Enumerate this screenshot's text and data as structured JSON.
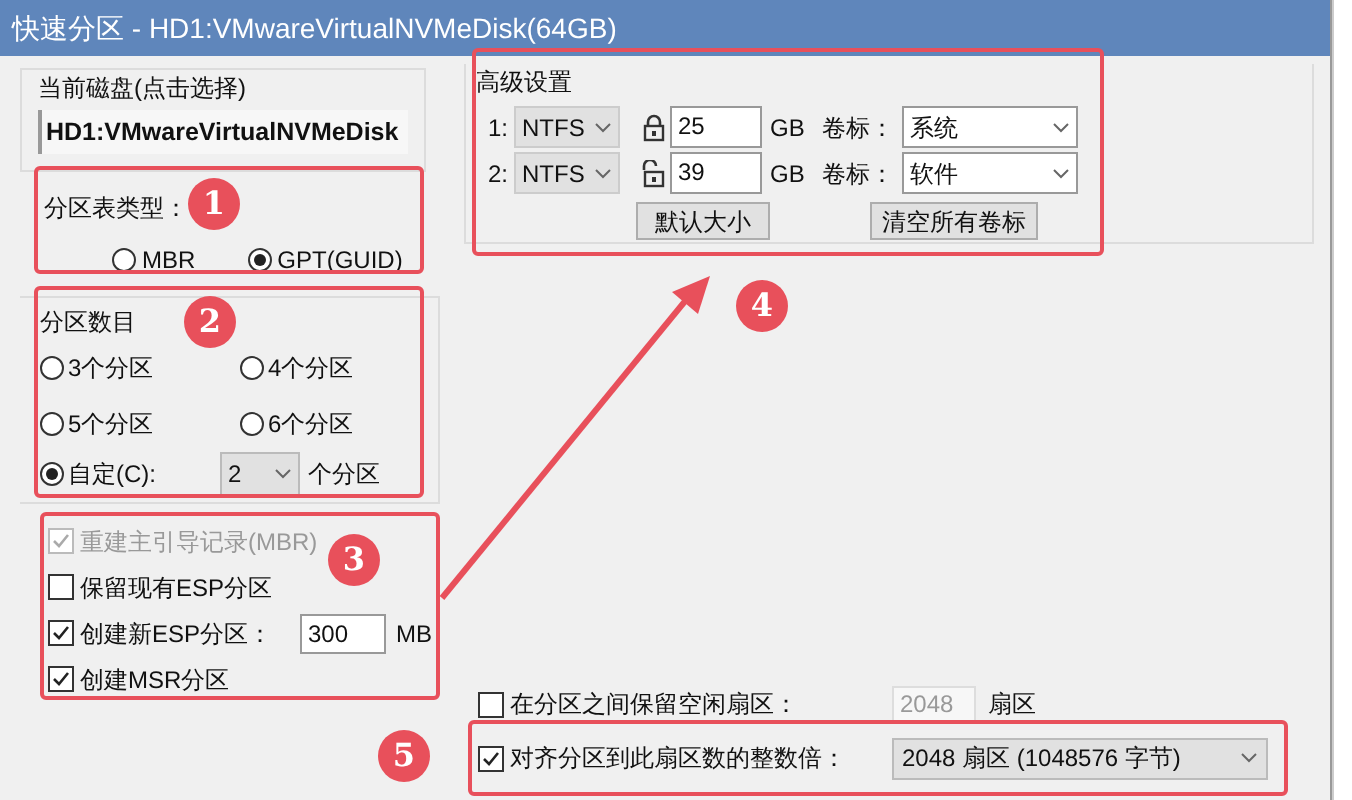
{
  "window": {
    "title": "快速分区 - HD1:VMwareVirtualNVMeDisk(64GB)"
  },
  "current_disk": {
    "label": "当前磁盘(点击选择)",
    "value": "HD1:VMwareVirtualNVMeDisk"
  },
  "partition_table": {
    "label": "分区表类型：",
    "options": [
      {
        "label": "MBR",
        "selected": false
      },
      {
        "label": "GPT(GUID)",
        "selected": true
      }
    ]
  },
  "partition_count": {
    "label": "分区数目",
    "options": [
      {
        "label": "3个分区",
        "selected": false
      },
      {
        "label": "4个分区",
        "selected": false
      },
      {
        "label": "5个分区",
        "selected": false
      },
      {
        "label": "6个分区",
        "selected": false
      }
    ],
    "custom": {
      "label": "自定(C):",
      "selected": true,
      "value": "2",
      "suffix": "个分区"
    }
  },
  "options": [
    {
      "label": "重建主引导记录(MBR)",
      "checked": true,
      "disabled": true
    },
    {
      "label": "保留现有ESP分区",
      "checked": false,
      "disabled": false
    },
    {
      "label": "创建新ESP分区：",
      "checked": true,
      "disabled": false,
      "value": "300",
      "unit": "MB"
    },
    {
      "label": "创建MSR分区",
      "checked": true,
      "disabled": false
    }
  ],
  "advanced": {
    "title": "高级设置",
    "partitions": [
      {
        "index": "1:",
        "fs": "NTFS",
        "locked": true,
        "size": "25",
        "unit": "GB",
        "volume_label": "卷标：",
        "volume": "系统"
      },
      {
        "index": "2:",
        "fs": "NTFS",
        "locked": false,
        "size": "39",
        "unit": "GB",
        "volume_label": "卷标：",
        "volume": "软件"
      }
    ],
    "buttons": [
      "默认大小",
      "清空所有卷标"
    ]
  },
  "gap": {
    "label": "在分区之间保留空闲扇区：",
    "checked": false,
    "disabled": true,
    "value": "2048",
    "unit": "扇区"
  },
  "align": {
    "label": "对齐分区到此扇区数的整数倍：",
    "checked": true,
    "value": "2048 扇区 (1048576 字节)"
  },
  "annotations": [
    "1",
    "2",
    "3",
    "4",
    "5"
  ]
}
